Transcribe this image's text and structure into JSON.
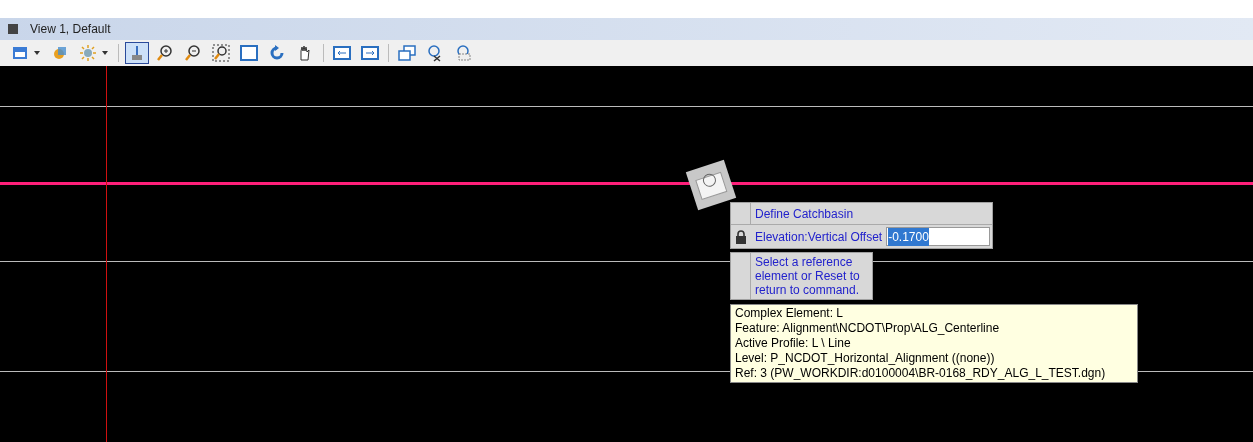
{
  "window": {
    "title": "View 1, Default"
  },
  "toolbar": [
    {
      "menu": true,
      "selected": false
    },
    {
      "menu": false,
      "selected": false
    },
    {
      "menu": true,
      "selected": false
    },
    {
      "menu": false,
      "selected": true
    },
    {
      "menu": false,
      "selected": false
    },
    {
      "menu": false,
      "selected": false
    },
    {
      "menu": false,
      "selected": false
    },
    {
      "menu": false,
      "selected": false
    },
    {
      "menu": false,
      "selected": false
    },
    {
      "menu": false,
      "selected": false
    },
    {
      "menu": false,
      "selected": false
    },
    {
      "menu": false,
      "selected": false
    },
    {
      "menu": false,
      "selected": false
    },
    {
      "menu": false,
      "selected": false
    },
    {
      "menu": false,
      "selected": false
    }
  ],
  "tool_settings": {
    "title": "Define Catchbasin",
    "field": {
      "label": "Elevation:Vertical Offset",
      "value": "-0.1700",
      "locked": true,
      "text_selected": true
    }
  },
  "prompt": "Select a reference element or Reset to return to command.",
  "tooltip": [
    "Complex Element: L",
    "Feature:  Alignment\\NCDOT\\Prop\\ALG_Centerline",
    "Active Profile: L \\ Line",
    "Level:  P_NCDOT_Horizontal_Alignment ((none))",
    "Ref: 3 (PW_WORKDIR:d0100004\\BR-0168_RDY_ALG_L_TEST.dgn)"
  ]
}
